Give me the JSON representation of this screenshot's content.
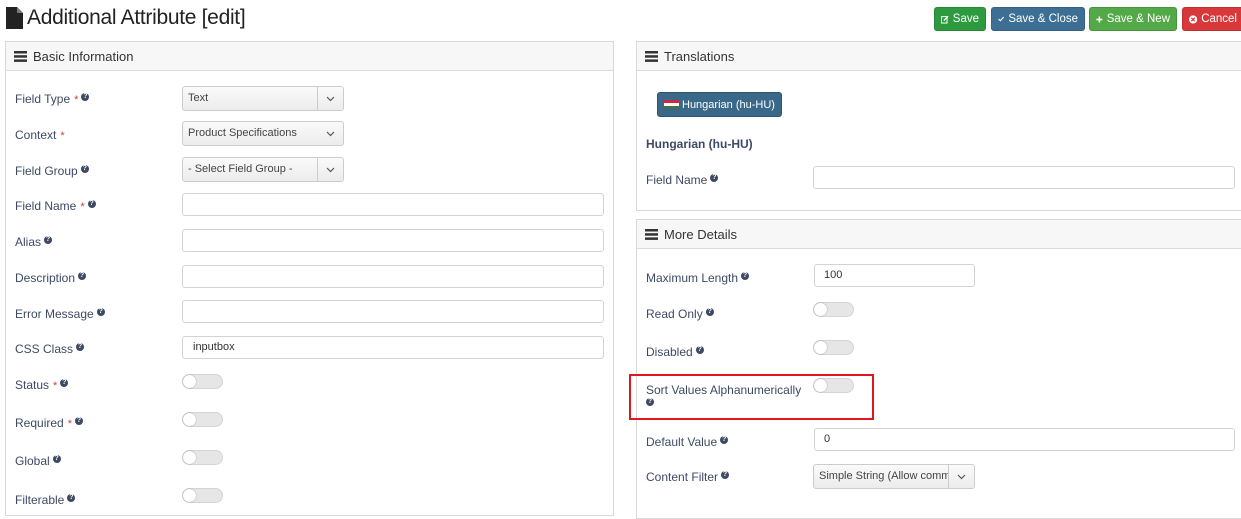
{
  "header": {
    "title": "Additional Attribute [edit]",
    "buttons": {
      "save": "Save",
      "save_close": "Save & Close",
      "save_new": "Save & New",
      "cancel": "Cancel"
    }
  },
  "basic": {
    "title": "Basic Information",
    "field_type": {
      "label": "Field Type",
      "value": "Text"
    },
    "context": {
      "label": "Context",
      "value": "Product Specifications"
    },
    "field_group": {
      "label": "Field Group",
      "value": "- Select Field Group -"
    },
    "field_name": {
      "label": "Field Name",
      "value": ""
    },
    "alias": {
      "label": "Alias",
      "value": ""
    },
    "description": {
      "label": "Description",
      "value": ""
    },
    "error_message": {
      "label": "Error Message",
      "value": ""
    },
    "css_class": {
      "label": "CSS Class",
      "value": "inputbox"
    },
    "status": {
      "label": "Status"
    },
    "required": {
      "label": "Required"
    },
    "global": {
      "label": "Global"
    },
    "filterable": {
      "label": "Filterable"
    },
    "required_mark": "*",
    "help_mark": "?"
  },
  "translations": {
    "title": "Translations",
    "language_button": "Hungarian (hu-HU)",
    "language_heading": "Hungarian (hu-HU)",
    "field_name": {
      "label": "Field Name",
      "value": ""
    },
    "flag_colors": [
      "#cd2a3e",
      "#ffffff",
      "#436f4d"
    ]
  },
  "details": {
    "title": "More Details",
    "max_length": {
      "label": "Maximum Length",
      "value": "100"
    },
    "read_only": {
      "label": "Read Only"
    },
    "disabled": {
      "label": "Disabled"
    },
    "sort_values": {
      "label": "Sort Values Alphanumerically"
    },
    "default_value": {
      "label": "Default Value",
      "value": "0"
    },
    "content_filter": {
      "label": "Content Filter",
      "value": "Simple String (Allow comm"
    }
  },
  "colors": {
    "save": "#2e9a3f",
    "save_close": "#3c6f93",
    "save_new": "#53a847",
    "cancel": "#d9383a",
    "highlight": "#e0171b"
  }
}
